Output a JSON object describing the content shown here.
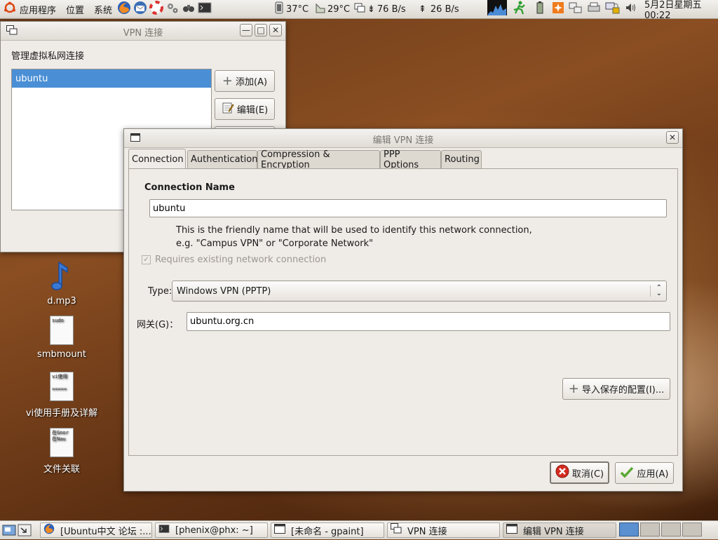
{
  "top_panel": {
    "menus": [
      "应用程序",
      "位置",
      "系统"
    ],
    "temp1": "37°C",
    "temp2": "29°C",
    "net_down": "76 B/s",
    "net_up": "26 B/s",
    "clock": "5月2日星期五 00:22"
  },
  "vpn_window": {
    "title": "VPN 连接",
    "heading": "管理虚拟私网连接",
    "connections": [
      "ubuntu"
    ],
    "add_button": "添加(A)",
    "edit_button": "编辑(E)"
  },
  "desktop_icons": [
    {
      "label": "d.mp3",
      "icon": "music-note-icon"
    },
    {
      "label": "smbmount",
      "thumb": "sudo"
    },
    {
      "label": "vi使用手册及详解",
      "thumb": "vi使用\n\n====="
    },
    {
      "label": "文件关联",
      "thumb": "在Gnor\n在Nau"
    }
  ],
  "edit_dialog": {
    "title": "编辑 VPN 连接",
    "tabs": [
      "Connection",
      "Authentication",
      "Compression & Encryption",
      "PPP Options",
      "Routing"
    ],
    "active_tab": "Connection",
    "connection_name_label": "Connection Name",
    "connection_name_value": "ubuntu",
    "help_line1": "This is the friendly name that will be used to identify this network connection,",
    "help_line2": "e.g. \"Campus VPN\" or \"Corporate Network\"",
    "requires_network_label": "Requires existing network connection",
    "requires_network_checked": true,
    "type_label": "Type:",
    "type_value": "Windows VPN (PPTP)",
    "gateway_label": "网关(G)：",
    "gateway_value": "ubuntu.org.cn",
    "import_button": "导入保存的配置(I)...",
    "cancel_button": "取消(C)",
    "apply_button": "应用(A)"
  },
  "taskbar": {
    "tasks": [
      "[Ubuntu中文 论坛 :...",
      "[phenix@phx: ~]",
      "[未命名 - gpaint]",
      "VPN 连接",
      "编辑 VPN 连接"
    ],
    "active_task": "编辑 VPN 连接"
  },
  "colors": {
    "selection": "#4a8fd6",
    "window_bg": "#efebe7",
    "cancel_red": "#d42a1f",
    "apply_green": "#5aa832"
  }
}
